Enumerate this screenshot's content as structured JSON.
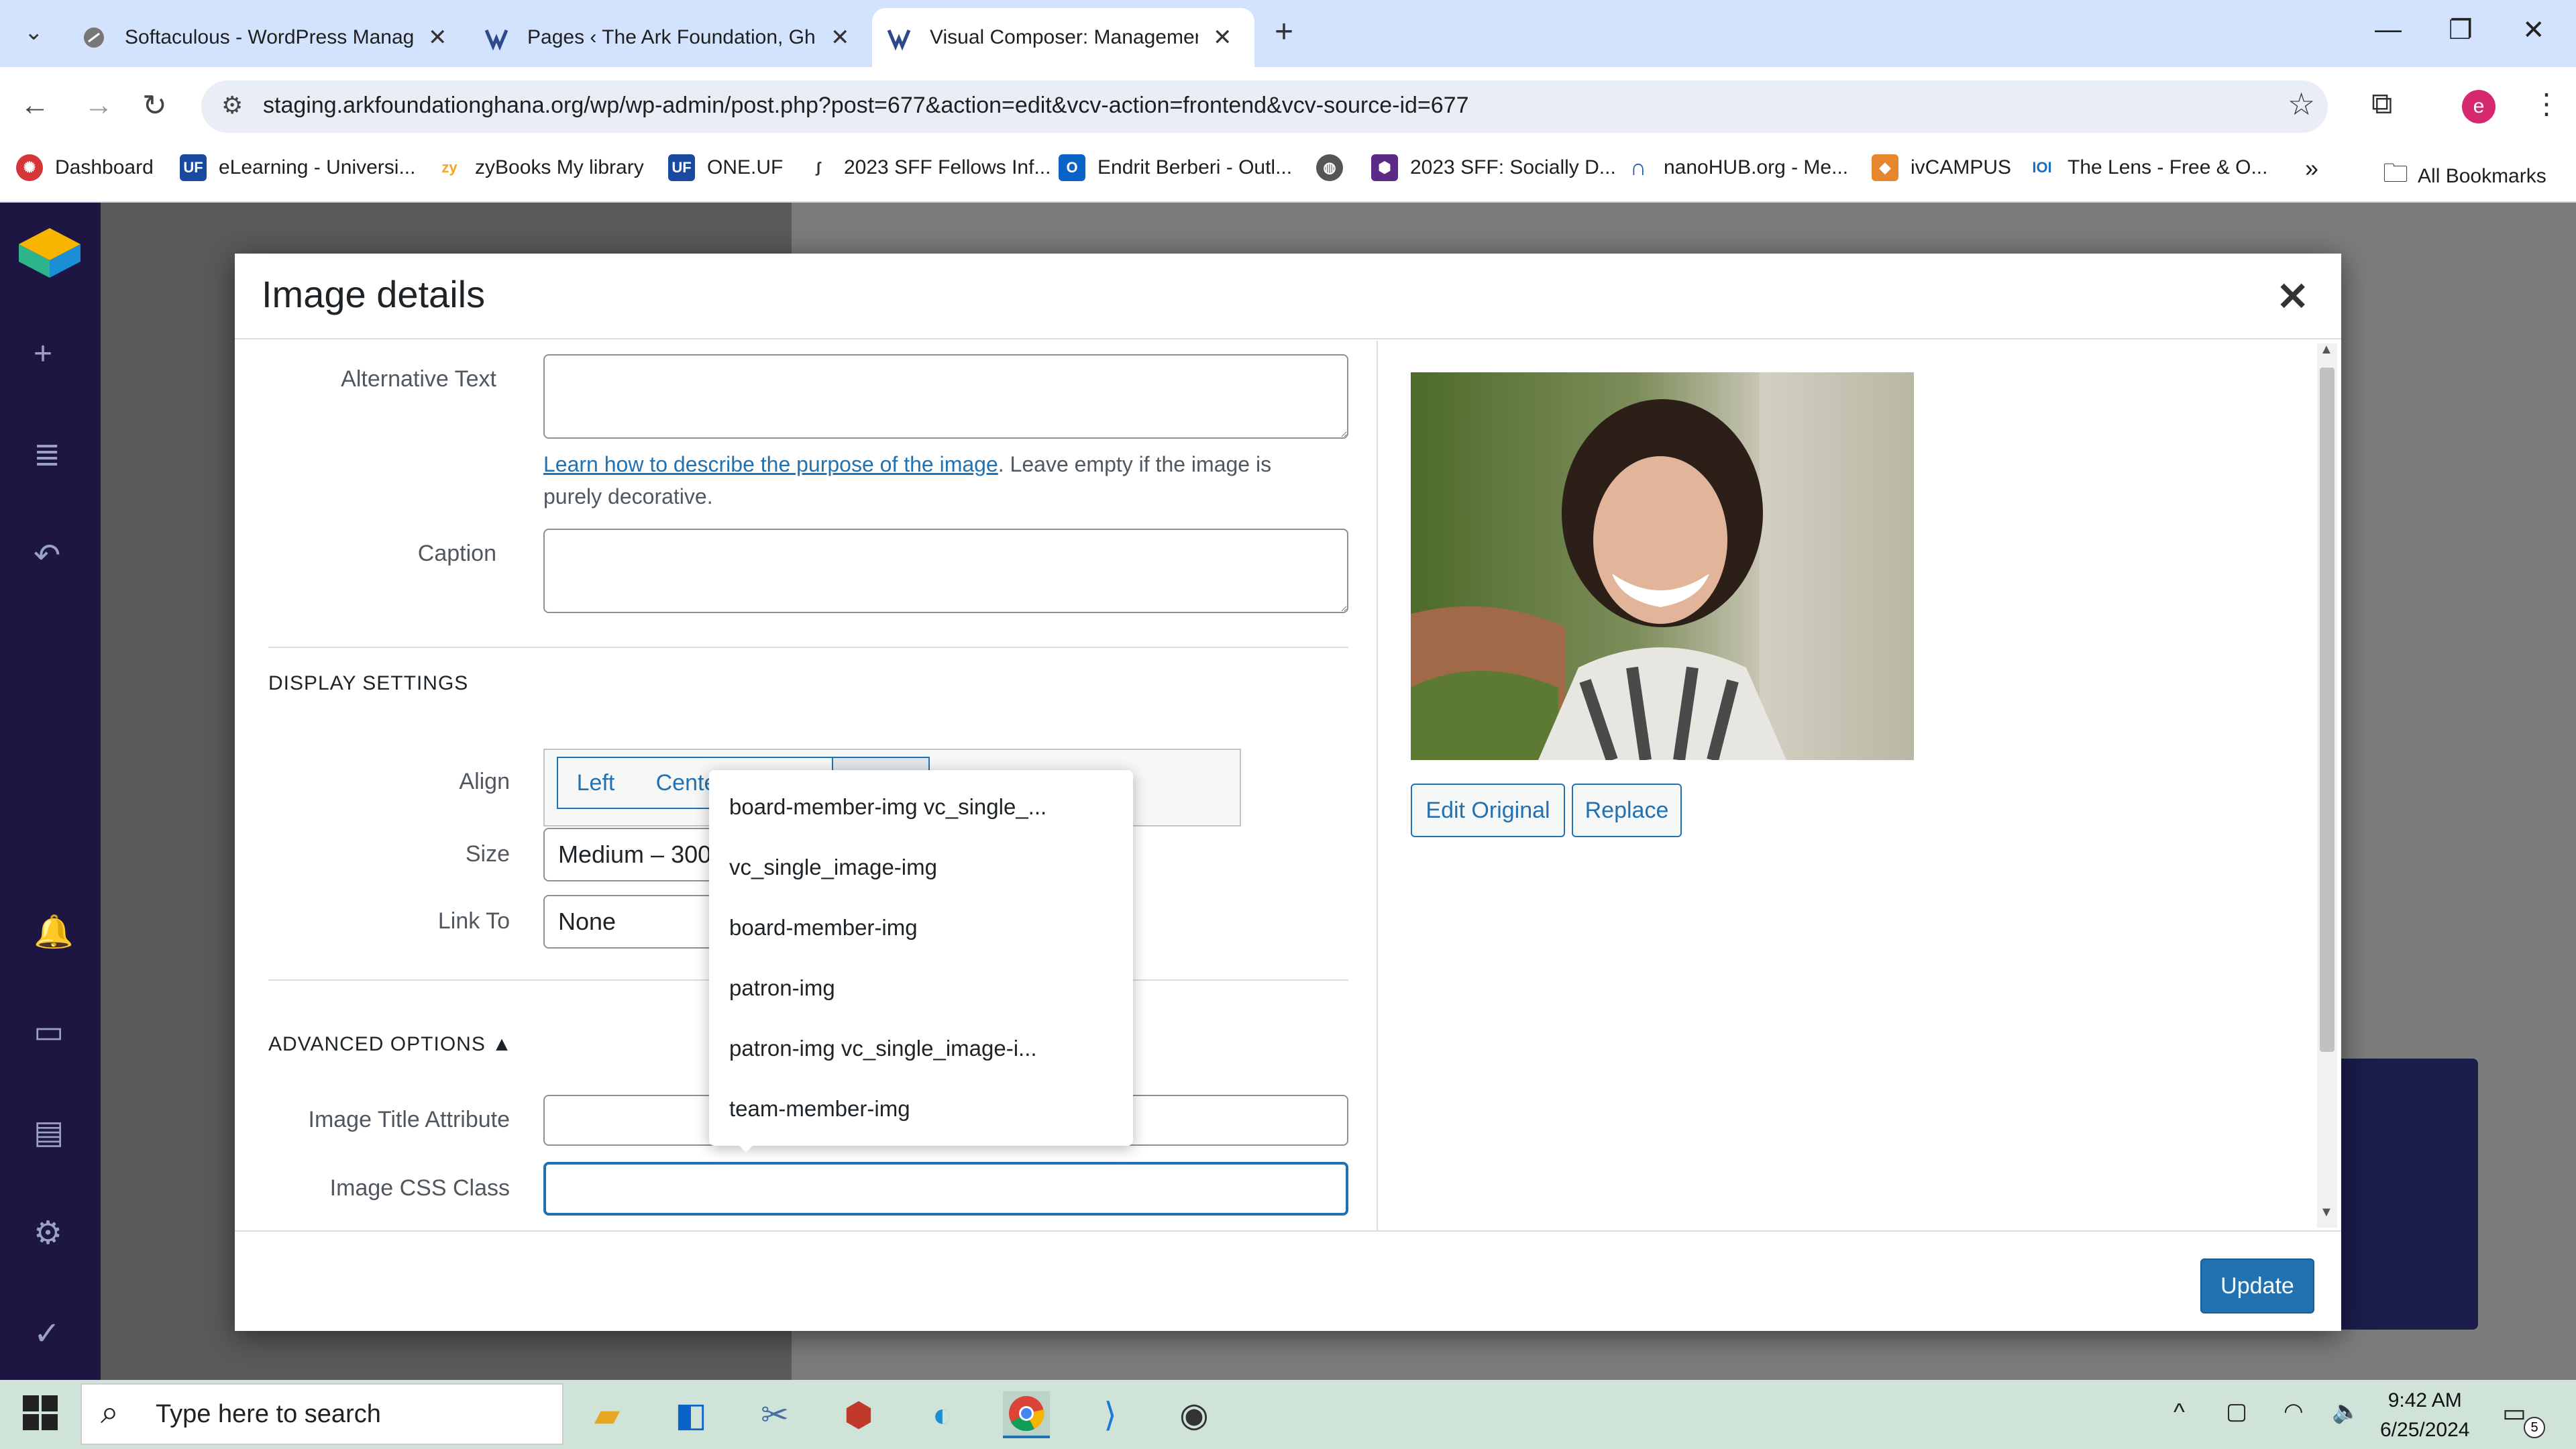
{
  "browser": {
    "tabs": [
      {
        "title": "Softaculous - WordPress Manag",
        "icon": "softaculous-icon"
      },
      {
        "title": "Pages ‹ The Ark Foundation, Gh",
        "icon": "wp-icon"
      },
      {
        "title": "Visual Composer: Management",
        "icon": "vc-icon"
      }
    ],
    "url": "staging.arkfoundationghana.org/wp/wp-admin/post.php?post=677&action=edit&vcv-action=frontend&vcv-source-id=677",
    "profile_initial": "e",
    "bookmarks": [
      {
        "label": "Dashboard",
        "color": "#d63638"
      },
      {
        "label": "eLearning - Universi...",
        "color": "#1a4aa0",
        "badge": "UF"
      },
      {
        "label": "zyBooks My library",
        "color": "#f5a623",
        "badge": "zy"
      },
      {
        "label": "ONE.UF",
        "color": "#1a4aa0",
        "badge": "UF"
      },
      {
        "label": "2023 SFF Fellows Inf...",
        "color": "#444"
      },
      {
        "label": "Endrit Berberi - Outl...",
        "color": "#0a64c8"
      },
      {
        "label": "",
        "color": "#555"
      },
      {
        "label": "2023 SFF: Socially D...",
        "color": "#5b2a86"
      },
      {
        "label": "nanoHUB.org - Me...",
        "color": "#2255aa"
      },
      {
        "label": "ivCAMPUS",
        "color": "#e6862d"
      },
      {
        "label": "The Lens - Free & O...",
        "color": "#1a6fc0"
      }
    ],
    "all_bookmarks": "All Bookmarks"
  },
  "modal": {
    "title": "Image details",
    "alt_text_label": "Alternative Text",
    "alt_text_value": "",
    "help_link": "Learn how to describe the purpose of the image",
    "help_rest": ". Leave empty if the image is purely decorative.",
    "caption_label": "Caption",
    "caption_value": "",
    "display_settings": "DISPLAY SETTINGS",
    "align_label": "Align",
    "align_options": [
      "Left",
      "Cente"
    ],
    "size_label": "Size",
    "size_value": "Medium – 300",
    "link_to_label": "Link To",
    "link_to_value": "None",
    "advanced_options": "ADVANCED OPTIONS ▲",
    "title_attr_label": "Image Title Attribute",
    "title_attr_value": "",
    "css_class_label": "Image CSS Class",
    "css_class_value": "",
    "edit_original": "Edit Original",
    "replace": "Replace",
    "update": "Update"
  },
  "autocomplete": [
    "board-member-img vc_single_...",
    "vc_single_image-img",
    "board-member-img",
    "patron-img",
    "patron-img vc_single_image-i...",
    "team-member-img"
  ],
  "taskbar": {
    "search_placeholder": "Type here to search",
    "time": "9:42 AM",
    "date": "6/25/2024",
    "notifications": "5"
  },
  "colors": {
    "accent": "#2271b1",
    "vc_dark": "#1d1542"
  }
}
